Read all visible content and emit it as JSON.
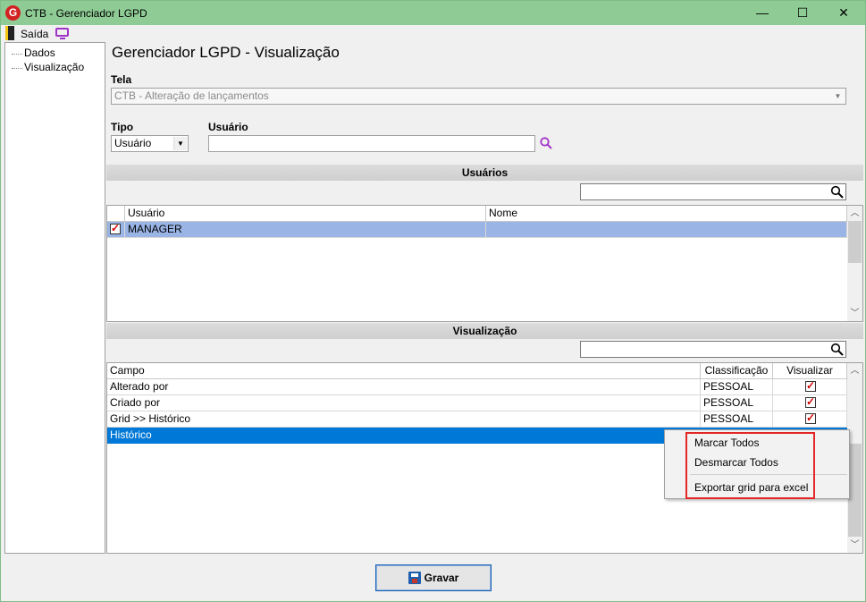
{
  "window": {
    "title": "CTB - Gerenciador LGPD",
    "app_icon_letter": "G",
    "minimize": "—",
    "maximize": "☐",
    "close": "✕"
  },
  "menu": {
    "exit_label": "Saída"
  },
  "sidebar": {
    "items": [
      {
        "label": "Dados"
      },
      {
        "label": "Visualização"
      }
    ]
  },
  "main": {
    "title": "Gerenciador LGPD - Visualização",
    "tela_label": "Tela",
    "tela_value": "CTB - Alteração de lançamentos",
    "tipo_label": "Tipo",
    "tipo_value": "Usuário",
    "usuario_label": "Usuário",
    "usuario_value": ""
  },
  "users_section": {
    "header": "Usuários",
    "filter_value": "",
    "columns": [
      "Usuário",
      "Nome"
    ],
    "rows": [
      {
        "checked": true,
        "usuario": "MANAGER",
        "nome": ""
      }
    ]
  },
  "view_section": {
    "header": "Visualização",
    "filter_value": "",
    "columns": [
      "Campo",
      "Classificação",
      "Visualizar"
    ],
    "rows": [
      {
        "campo": "Alterado por",
        "classificacao": "PESSOAL",
        "visualizar": true
      },
      {
        "campo": "Criado por",
        "classificacao": "PESSOAL",
        "visualizar": true
      },
      {
        "campo": "Grid >> Histórico",
        "classificacao": "PESSOAL",
        "visualizar": true
      },
      {
        "campo": "Histórico",
        "classificacao": "",
        "visualizar": false,
        "selected": true
      }
    ]
  },
  "context_menu": {
    "items": [
      "Marcar Todos",
      "Desmarcar Todos",
      "Exportar grid para excel"
    ]
  },
  "footer": {
    "save_label": "Gravar"
  },
  "colors": {
    "titlebar": "#8fcc95",
    "selection": "#0078d7",
    "user_row_selection": "#99b4e5",
    "highlight_box": "#e32626"
  }
}
